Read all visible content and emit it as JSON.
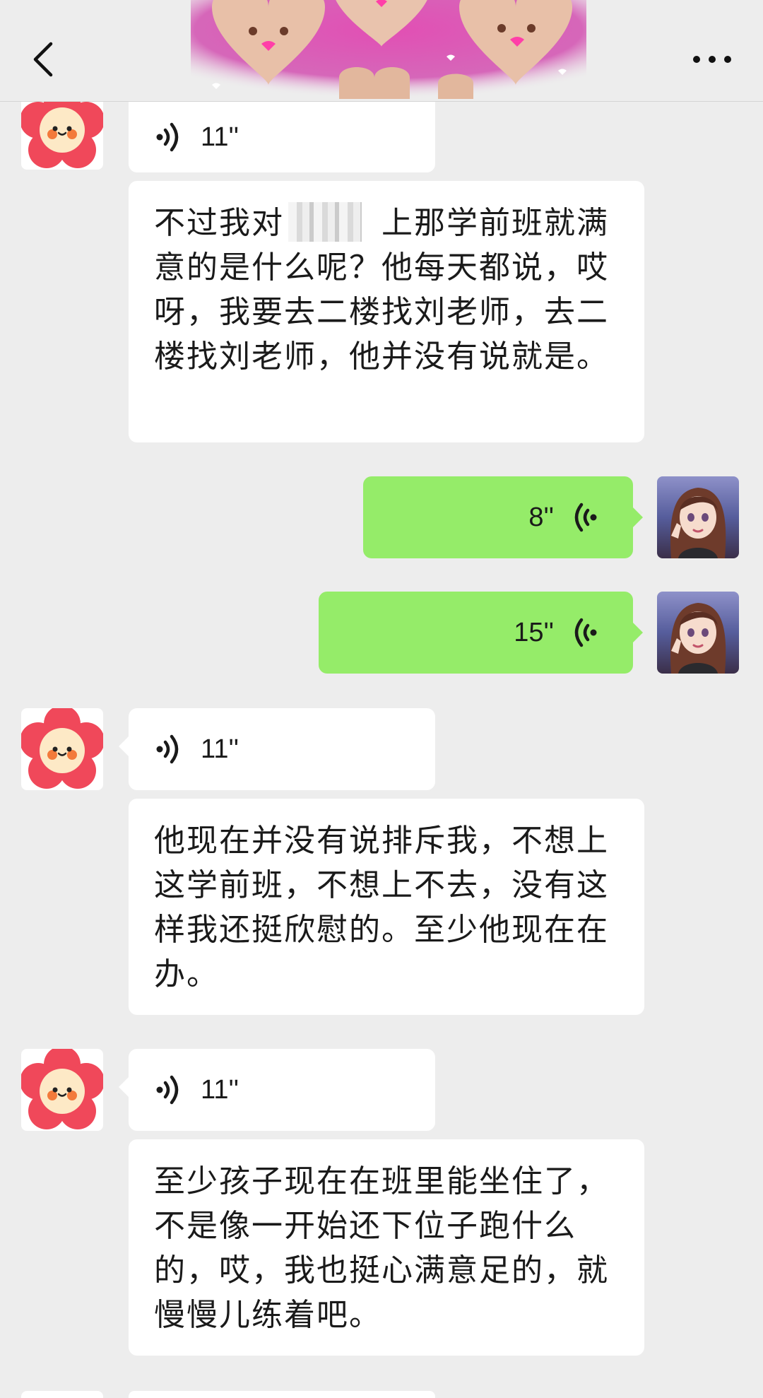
{
  "header": {
    "back_icon": "chevron-left-icon",
    "more_icon": "ellipsis-icon"
  },
  "messages": [
    {
      "type": "voice",
      "side": "left",
      "duration": "11''",
      "avatar": "flower-avatar",
      "transcript": "不过我对　　　上那学前班就满意的是什么呢？他每天都说，哎呀，我要去二楼找刘老师，去二楼找刘老师，他并没有说就是。"
    },
    {
      "type": "voice",
      "side": "right",
      "duration": "8''",
      "avatar": "girl-avatar"
    },
    {
      "type": "voice",
      "side": "right",
      "duration": "15''",
      "avatar": "girl-avatar"
    },
    {
      "type": "voice",
      "side": "left",
      "duration": "11''",
      "avatar": "flower-avatar",
      "transcript": "他现在并没有说排斥我，不想上这学前班，不想上不去，没有这样我还挺欣慰的。至少他现在在办。"
    },
    {
      "type": "voice",
      "side": "left",
      "duration": "11''",
      "avatar": "flower-avatar",
      "transcript": "至少孩子现在在班里能坐住了，不是像一开始还下位子跑什么的，哎，我也挺心满意足的，就慢慢儿练着吧。"
    }
  ],
  "colors": {
    "background": "#ededed",
    "bubble_self": "#95ec69",
    "bubble_other": "#ffffff",
    "flower": "#f0485a"
  }
}
